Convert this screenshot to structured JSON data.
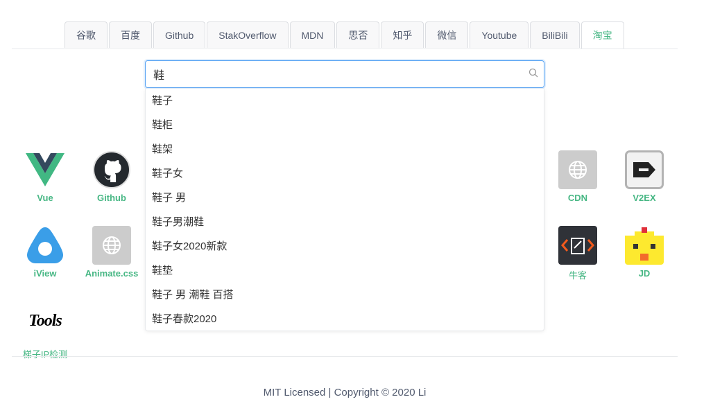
{
  "tabs": [
    "谷歌",
    "百度",
    "Github",
    "StakOverflow",
    "MDN",
    "思否",
    "知乎",
    "微信",
    "Youtube",
    "BiliBili",
    "淘宝"
  ],
  "active_tab": "淘宝",
  "search": {
    "value": "鞋",
    "icon": "search-icon"
  },
  "suggestions": [
    "鞋子",
    "鞋柜",
    "鞋架",
    "鞋子女",
    "鞋子 男",
    "鞋子男潮鞋",
    "鞋子女2020新款",
    "鞋垫",
    "鞋子 男 潮鞋 百搭",
    "鞋子春款2020"
  ],
  "sites": {
    "vue": "Vue",
    "github": "Github",
    "iview": "iView",
    "animate": "Animate.css",
    "tools": "梯子IP检测",
    "cdn": "CDN",
    "v2ex": "V2EX",
    "nowcoder": "牛客",
    "jd": "JD"
  },
  "tools_logo_text": "Tools",
  "footer": "MIT Licensed | Copyright © 2020 Li",
  "colors": {
    "accent": "#47b784",
    "focus": "#57a3f3"
  }
}
